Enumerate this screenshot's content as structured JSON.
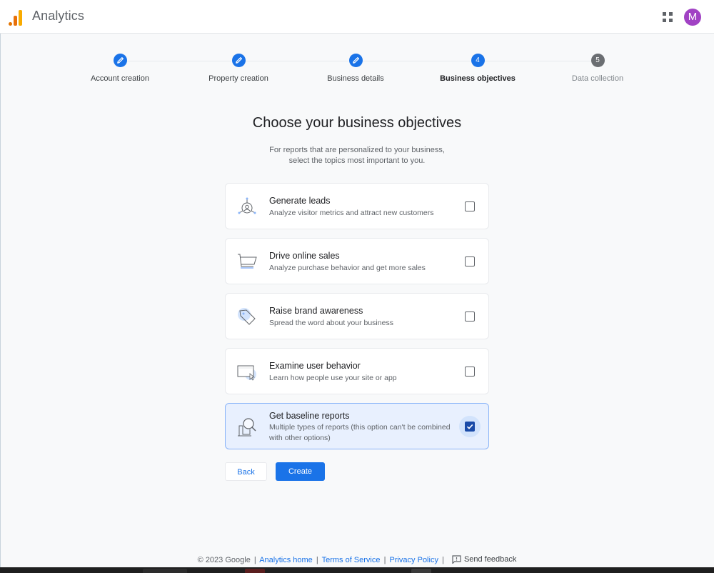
{
  "header": {
    "app_title": "Analytics",
    "apps_icon": "apps-grid-icon",
    "avatar_initial": "M",
    "avatar_color": "#a142c4"
  },
  "stepper": {
    "steps": [
      {
        "label": "Account creation",
        "state": "done",
        "icon": "pencil-icon"
      },
      {
        "label": "Property creation",
        "state": "done",
        "icon": "pencil-icon"
      },
      {
        "label": "Business details",
        "state": "done",
        "icon": "pencil-icon"
      },
      {
        "label": "Business objectives",
        "state": "active",
        "number": "4"
      },
      {
        "label": "Data collection",
        "state": "pending",
        "number": "5"
      }
    ]
  },
  "main": {
    "title": "Choose your business objectives",
    "subtitle_line1": "For reports that are personalized to your business,",
    "subtitle_line2": "select the topics most important to you.",
    "objectives": [
      {
        "title": "Generate leads",
        "description": "Analyze visitor metrics and attract new customers",
        "icon": "leads-icon",
        "checked": false
      },
      {
        "title": "Drive online sales",
        "description": "Analyze purchase behavior and get more sales",
        "icon": "cart-icon",
        "checked": false
      },
      {
        "title": "Raise brand awareness",
        "description": "Spread the word about your business",
        "icon": "tag-icon",
        "checked": false
      },
      {
        "title": "Examine user behavior",
        "description": "Learn how people use your site or app",
        "icon": "screen-cursor-icon",
        "checked": false
      },
      {
        "title": "Get baseline reports",
        "description": "Multiple types of reports (this option can't be combined with other options)",
        "icon": "magnifier-report-icon",
        "checked": true
      }
    ],
    "back_label": "Back",
    "create_label": "Create"
  },
  "footer": {
    "copyright": "© 2023 Google",
    "links": [
      "Analytics home",
      "Terms of Service",
      "Privacy Policy"
    ],
    "feedback_label": "Send feedback"
  },
  "colors": {
    "accent": "#1a73e8",
    "selected_card_bg": "#e8f0fe",
    "page_bg": "#f8f9fa"
  }
}
